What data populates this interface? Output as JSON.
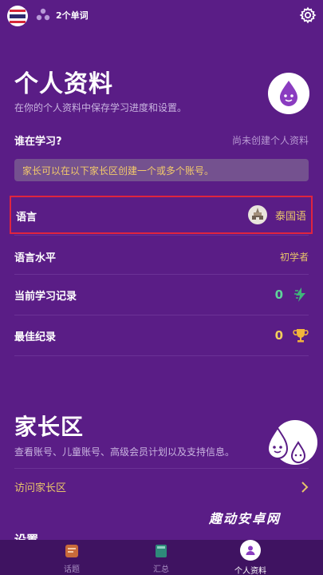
{
  "topbar": {
    "flag_icon": "thai-flag-icon",
    "word_count": "2个单词",
    "settings_icon": "gear-icon"
  },
  "profile": {
    "title": "个人资料",
    "subtitle": "在你的个人资料中保存学习进度和设置。",
    "who_label": "谁在学习?",
    "who_value": "尚未创建个人资料",
    "notice": "家长可以在以下家长区创建一个或多个账号。",
    "language_label": "语言",
    "language_value": "泰国语",
    "level_label": "语言水平",
    "level_value": "初学者",
    "streak_label": "当前学习记录",
    "streak_value": "0",
    "best_label": "最佳纪录",
    "best_value": "0"
  },
  "parents": {
    "title": "家长区",
    "subtitle": "查看账号、儿童账号、高级会员计划以及支持信息。",
    "visit_label": "访问家长区"
  },
  "settings": {
    "title": "设置"
  },
  "watermark": "趣动安卓网",
  "nav": {
    "topics": "话题",
    "summary": "汇总",
    "profile": "个人资料"
  },
  "colors": {
    "background": "#5a1d86",
    "accent_gold": "#e8c46a",
    "highlight_red": "#e0243f",
    "streak_green": "#5fd49a"
  }
}
